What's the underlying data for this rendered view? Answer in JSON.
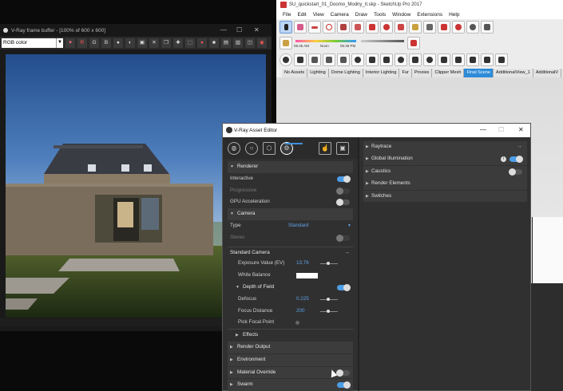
{
  "sketchup": {
    "title": "SU_quickstart_01_Doomo_Modny_II.skp - SketchUp Pro 2017",
    "menu": [
      "File",
      "Edit",
      "View",
      "Camera",
      "Draw",
      "Tools",
      "Window",
      "Extensions",
      "Help"
    ],
    "sun_times": [
      "05:45 AM",
      "Noon",
      "05:48 PM"
    ],
    "scene_tabs": [
      "No Assets",
      "Lighting",
      "Dome Lighting",
      "Interior Lighting",
      "Fur",
      "Proxies",
      "Clipper Mesh",
      "Final Scene",
      "AdditionalView_1",
      "AdditionalV"
    ],
    "active_tab": "Final Scene"
  },
  "frame_buffer": {
    "title": "V-Ray frame buffer - [100% of 600 x 600]",
    "channel": "RGB color",
    "buttons": [
      "R",
      "G",
      "B"
    ]
  },
  "asset_editor": {
    "title": "V-Ray Asset Editor",
    "left": {
      "renderer": "Renderer",
      "interactive": "Interactive",
      "progressive": "Progressive",
      "gpu": "GPU Acceleration",
      "camera": "Camera",
      "type_label": "Type",
      "type_value": "Standard",
      "stereo": "Stereo",
      "standard_camera": "Standard Camera",
      "exposure_label": "Exposure Value (EV)",
      "exposure_value": "13.76",
      "white_balance": "White Balance",
      "dof": "Depth of Field",
      "defocus_label": "Defocus",
      "defocus_value": "0.225",
      "focus_label": "Focus Distance",
      "focus_value": "200",
      "pick_focal": "Pick Focal Point",
      "effects": "Effects",
      "render_output": "Render Output",
      "environment": "Environment",
      "material_override": "Material Override",
      "swarm": "Swarm"
    },
    "right": [
      "Raytrace",
      "Global Illumination",
      "Caustics",
      "Render Elements",
      "Switches"
    ]
  }
}
